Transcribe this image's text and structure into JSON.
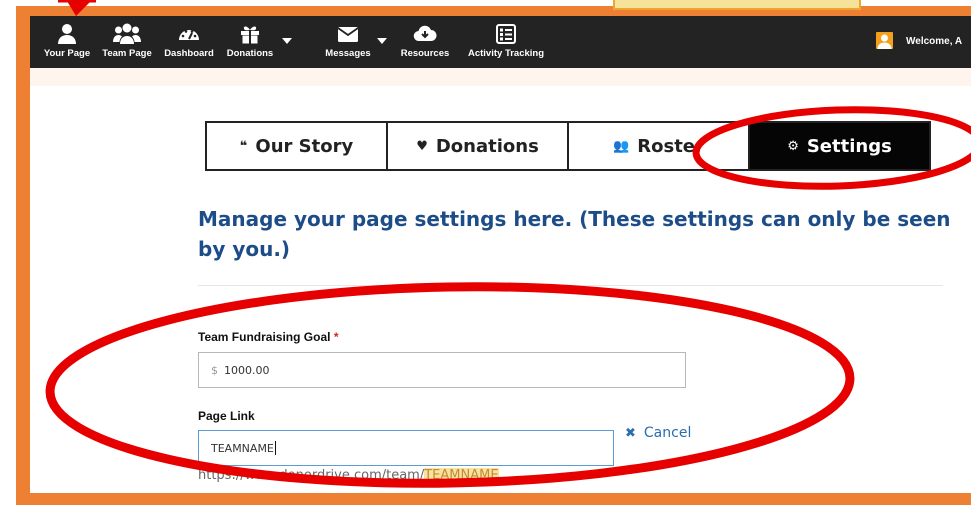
{
  "nav": {
    "items": [
      {
        "label": "Your Page",
        "icon": "user-icon"
      },
      {
        "label": "Team Page",
        "icon": "users-icon"
      },
      {
        "label": "Dashboard",
        "icon": "gauge-icon"
      },
      {
        "label": "Donations",
        "icon": "gift-icon"
      },
      {
        "label": "Messages",
        "icon": "envelope-icon"
      },
      {
        "label": "Resources",
        "icon": "cloud-download-icon"
      },
      {
        "label": "Activity Tracking",
        "icon": "checklist-icon"
      }
    ],
    "welcome": "Welcome, A"
  },
  "tabs": [
    {
      "label": "Our Story",
      "icon": "quote-icon",
      "glyph": "❝"
    },
    {
      "label": "Donations",
      "icon": "heart-icon",
      "glyph": "♥"
    },
    {
      "label": "Roster",
      "icon": "users-icon",
      "glyph": "👥"
    },
    {
      "label": "Settings",
      "icon": "gear-icon",
      "glyph": "⚙"
    }
  ],
  "page": {
    "heading": "Manage your page settings here. (These settings can only be seen by you.)"
  },
  "form": {
    "goal_label": "Team Fundraising Goal",
    "goal_required": "*",
    "goal_prefix": "$",
    "goal_value": "1000.00",
    "link_label": "Page Link",
    "link_value": "TEAMNAME",
    "cancel_label": "Cancel",
    "url_prefix": "https://www.donordrive.com/team/",
    "url_team": "TEAMNAME"
  },
  "colors": {
    "frame": "#ee8034",
    "annotation": "#e60000",
    "heading": "#1d4d88",
    "link": "#2a6db0"
  }
}
